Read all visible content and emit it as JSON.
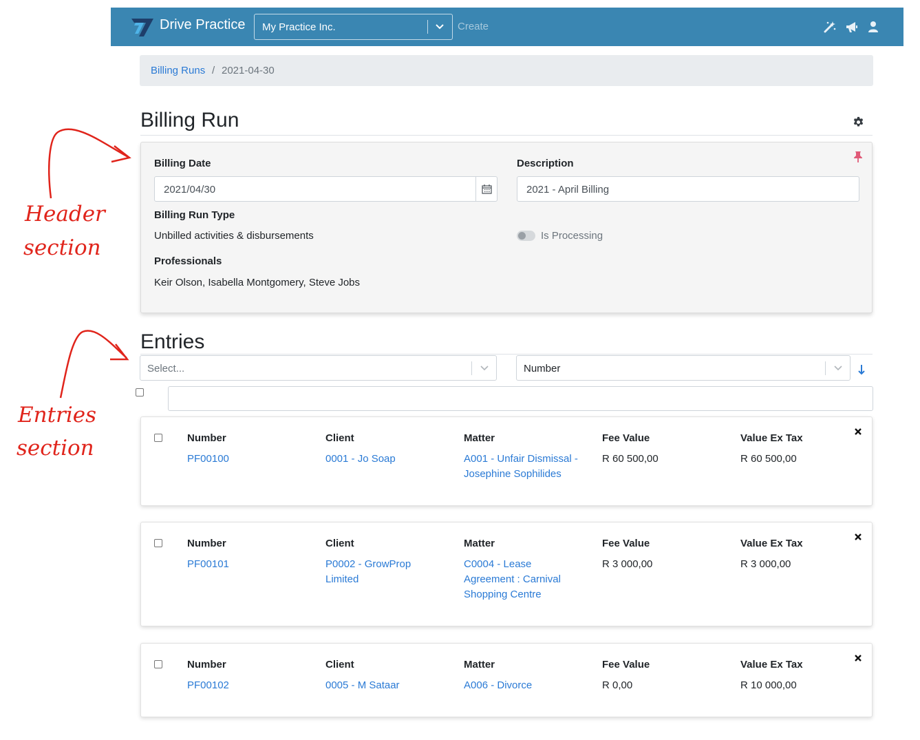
{
  "annotations": {
    "header_line1": "Header",
    "header_line2": "section",
    "entries_line1": "Entries",
    "entries_line2": "section",
    "color": "#e0241b"
  },
  "navbar": {
    "brand": "Drive Practice",
    "practice_select": "My Practice Inc.",
    "create_label": "Create",
    "bg_color": "#3a86b2",
    "icons": [
      "magic-wand-icon",
      "megaphone-icon",
      "user-icon"
    ]
  },
  "breadcrumb": {
    "link": "Billing Runs",
    "separator": "/",
    "current": "2021-04-30"
  },
  "billing_run": {
    "title": "Billing Run",
    "billing_date_label": "Billing Date",
    "billing_date_value": "2021/04/30",
    "description_label": "Description",
    "description_value": "2021 - April Billing",
    "type_label": "Billing Run Type",
    "type_value": "Unbilled activities & disbursements",
    "is_processing_label": "Is Processing",
    "is_processing": false,
    "professionals_label": "Professionals",
    "professionals_value": "Keir Olson, Isabella Montgomery, Steve Jobs"
  },
  "entries": {
    "title": "Entries",
    "group_placeholder": "Select...",
    "sort_value": "Number",
    "columns": {
      "number": "Number",
      "client": "Client",
      "matter": "Matter",
      "fee_value": "Fee Value",
      "value_ex_tax": "Value Ex Tax"
    },
    "rows": [
      {
        "number": "PF00100",
        "client": "0001 - Jo Soap",
        "matter": "A001 - Unfair Dismissal - Josephine Sophilides",
        "fee_value": "R 60 500,00",
        "value_ex_tax": "R 60 500,00"
      },
      {
        "number": "PF00101",
        "client": "P0002 - GrowProp Limited",
        "matter": "C0004 - Lease Agreement : Carnival Shopping Centre",
        "fee_value": "R 3 000,00",
        "value_ex_tax": "R 3 000,00"
      },
      {
        "number": "PF00102",
        "client": "0005 - M Sataar",
        "matter": "A006 - Divorce",
        "fee_value": "R 0,00",
        "value_ex_tax": "R 10 000,00"
      }
    ]
  },
  "colors": {
    "link": "#2a7ad5",
    "pin": "#e05a78"
  }
}
